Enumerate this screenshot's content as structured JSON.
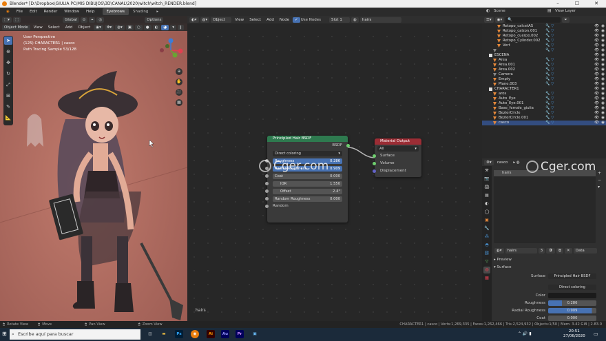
{
  "window": {
    "title": "Blender* [D:\\Dropbox\\GIULIA PC\\MIS DIBUJOS\\3D\\CANAL\\2020\\witch\\witch_RENDER.blend]"
  },
  "menubar": {
    "items": [
      "File",
      "Edit",
      "Render",
      "Window",
      "Help"
    ],
    "workspaces": [
      "Eyebrows",
      "Shading"
    ],
    "scene_label": "Scene",
    "view_layer_label": "View Layer"
  },
  "viewport": {
    "mode": "Object Mode",
    "menus": [
      "View",
      "Select",
      "Add",
      "Object"
    ],
    "orientation_label": "Global",
    "options_label": "Options",
    "info": [
      "User Perspective",
      "(125) CHARACTER1 | casco",
      "Path Tracing Sample 53/128"
    ]
  },
  "node_editor": {
    "type_label": "Object",
    "menus": [
      "View",
      "Select",
      "Add",
      "Node"
    ],
    "use_nodes_label": "Use Nodes",
    "slot_label": "Slot 1",
    "material_name": "hairs",
    "footer_label": "hairs",
    "hair_node": {
      "title": "Principled Hair BSDF",
      "output_label": "BSDF",
      "mode": "Direct coloring",
      "fields": [
        {
          "label": "Roughness",
          "value": "0.286",
          "highlight": true
        },
        {
          "label": "Radial Roughness",
          "value": "0.909",
          "highlight": true
        },
        {
          "label": "Coat",
          "value": "0.000",
          "highlight": false
        },
        {
          "label": "IOR",
          "value": "1.550",
          "highlight": false
        },
        {
          "label": "Offset",
          "value": "2.4°",
          "highlight": false
        },
        {
          "label": "Random Roughness",
          "value": "0.000",
          "highlight": false
        }
      ],
      "last_input": "Random"
    },
    "output_node": {
      "title": "Material Output",
      "target": "All",
      "inputs": [
        "Surface",
        "Volume",
        "Displacement"
      ]
    }
  },
  "watermark": "Cger.com",
  "outliner": {
    "rows": [
      {
        "label": "Retopo_calcetAS",
        "indent": 3,
        "color": "#e5883a",
        "selected": false
      },
      {
        "label": "Retopo_calzon.001",
        "indent": 3,
        "color": "#e5883a",
        "selected": false
      },
      {
        "label": "Retopo_cuerpo.002",
        "indent": 3,
        "color": "#e5883a",
        "selected": false
      },
      {
        "label": "Retopo_Cylinder.002",
        "indent": 3,
        "color": "#e5883a",
        "selected": false
      },
      {
        "label": "Vert",
        "indent": 3,
        "color": "#e5883a",
        "selected": false
      },
      {
        "label": "",
        "indent": 2,
        "color": "#888888",
        "selected": false
      },
      {
        "label": "ESCENA",
        "indent": 1,
        "color": "#dddddd",
        "selected": false
      },
      {
        "label": "Area",
        "indent": 2,
        "color": "#e5883a",
        "selected": false
      },
      {
        "label": "Area.001",
        "indent": 2,
        "color": "#e5883a",
        "selected": false
      },
      {
        "label": "Area.002",
        "indent": 2,
        "color": "#e5883a",
        "selected": false
      },
      {
        "label": "Camera",
        "indent": 2,
        "color": "#888888",
        "selected": false
      },
      {
        "label": "Empty",
        "indent": 2,
        "color": "#e5883a",
        "selected": false
      },
      {
        "label": "Plane.003",
        "indent": 2,
        "color": "#e5883a",
        "selected": false
      },
      {
        "label": "CHARACTER1",
        "indent": 1,
        "color": "#dddddd",
        "selected": false
      },
      {
        "label": "aros",
        "indent": 2,
        "color": "#e5883a",
        "selected": false
      },
      {
        "label": "Auto_Eye",
        "indent": 2,
        "color": "#e5883a",
        "selected": false
      },
      {
        "label": "Auto_Eye.001",
        "indent": 2,
        "color": "#e5883a",
        "selected": false
      },
      {
        "label": "Base_female_giulia",
        "indent": 2,
        "color": "#e5883a",
        "selected": false
      },
      {
        "label": "BezierCircle",
        "indent": 2,
        "color": "#e5883a",
        "selected": false
      },
      {
        "label": "BezierCircle.001",
        "indent": 2,
        "color": "#e5883a",
        "selected": false
      },
      {
        "label": "casco",
        "indent": 2,
        "color": "#e5883a",
        "selected": true
      }
    ]
  },
  "properties": {
    "object_name": "casco",
    "material_slot": "hairs",
    "material_name": "hairs",
    "users": "3",
    "link_label": "Data",
    "preview_label": "Preview",
    "surface_panel": "Surface",
    "surface_label": "Surface",
    "surface_value": "Principled Hair BSDF",
    "mode_value": "Direct coloring",
    "rows": [
      {
        "label": "Color",
        "value": ""
      },
      {
        "label": "Roughness",
        "value": "0.286"
      },
      {
        "label": "Radial Roughness",
        "value": "0.909"
      },
      {
        "label": "Coat",
        "value": "0.000"
      }
    ]
  },
  "statusbar": {
    "left": [
      "Rotate View",
      "Move",
      "Pan View",
      "Zoom View"
    ],
    "right": "CHARACTER1 | casco | Verts:1,269,335 | Faces:1,262,466 | Tris:2,524,932 | Objects:1/50 | Mem: 3.42 GiB | 2.83.0"
  },
  "taskbar": {
    "search_placeholder": "Escribe aquí para buscar",
    "apps": [
      "Ps",
      "Ai",
      "Au",
      "Pr"
    ],
    "time": "20:51",
    "date": "27/06/2020"
  }
}
